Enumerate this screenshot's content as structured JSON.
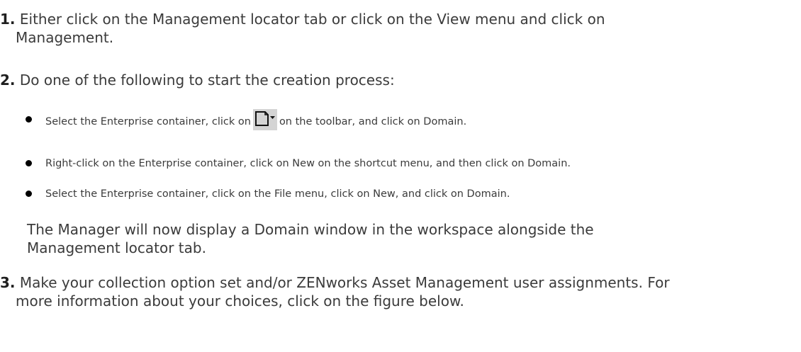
{
  "steps": [
    {
      "number": "1.",
      "line1": "Either click on the Management locator tab or click on the View menu and click on",
      "line2": "Management."
    },
    {
      "number": "2.",
      "text": "Do one of the following to start the creation process:"
    },
    {
      "number": "3.",
      "line1": "Make your collection option set and/or ZENworks Asset Management user assignments. For",
      "line2": "more information about your choices, click on the figure below."
    }
  ],
  "bullets": {
    "b1_before": "Select the Enterprise container, click on",
    "b1_after": "on the toolbar, and click on Domain.",
    "b2": "Right-click on the Enterprise container, click on New on the shortcut menu, and then click on Domain.",
    "b3": "Select the Enterprise container, click on the File menu, click on New, and click on Domain."
  },
  "icons": {
    "new_item": "new-document-dropdown-icon",
    "bullet": "bullet-dot-icon"
  },
  "note": {
    "line1": "The Manager will now display a Domain window in the workspace alongside the",
    "line2": "Management locator tab."
  }
}
